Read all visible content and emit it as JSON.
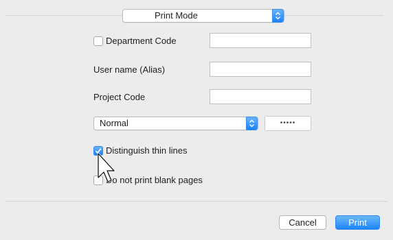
{
  "section_popup": {
    "value": "Print Mode"
  },
  "department_code": {
    "label": "Department Code",
    "checked": false,
    "value": ""
  },
  "user_name": {
    "label": "User name (Alias)",
    "value": ""
  },
  "project_code": {
    "label": "Project Code",
    "value": ""
  },
  "mode_popup": {
    "value": "Normal"
  },
  "password_button": {
    "label": "•••••"
  },
  "distinguish_thin_lines": {
    "label": "Distinguish thin lines",
    "checked": true
  },
  "no_blank_pages": {
    "label": "Do not print blank pages",
    "checked": false
  },
  "footer": {
    "cancel_label": "Cancel",
    "print_label": "Print"
  },
  "colors": {
    "accent": "#1a82fb"
  }
}
